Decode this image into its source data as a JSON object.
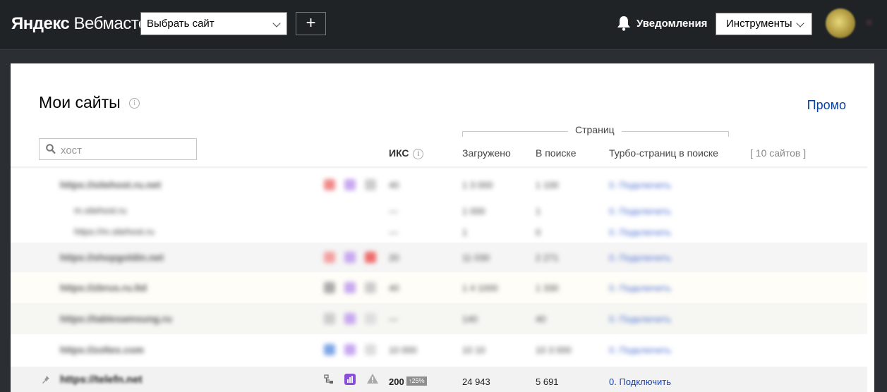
{
  "header": {
    "logo_bold": "Яндекс",
    "logo_rest": "Вебмастер",
    "site_select": "Выбрать сайт",
    "add_label": "+",
    "notifications": "Уведомления",
    "tools": "Инструменты"
  },
  "page": {
    "title": "Мои сайты",
    "info_glyph": "i",
    "promo": "Промо",
    "search_placeholder": "хост"
  },
  "table": {
    "group_label": "Страниц",
    "col_iks": "ИКС",
    "col_loaded": "Загружено",
    "col_in_search": "В поиске",
    "col_turbo": "Турбо-страниц в поиске",
    "site_count": "[ 10 сайтов ]"
  },
  "last_row": {
    "host": "https://telefn.net",
    "iks": "200",
    "iks_change": "↑25%",
    "loaded": "24 943",
    "in_search": "5 691",
    "turbo": "0. Подключить"
  },
  "blurred_rows": [
    {
      "host": "https://sitehost.ru.net",
      "iks": "40",
      "loaded": "1 3 000",
      "in_search": "1 100",
      "turbo": "0. Подключить"
    },
    {
      "host": "m.sitehost.ru",
      "iks": "—",
      "loaded": "1 000",
      "in_search": "1",
      "turbo": "0. Подключить"
    },
    {
      "host": "https://m.sitehost.ru",
      "iks": "—",
      "loaded": "1",
      "in_search": "0",
      "turbo": "0. Подключить"
    },
    {
      "host": "https://shopgoldin.net",
      "iks": "20",
      "loaded": "11 030",
      "in_search": "2 271",
      "turbo": "0. Подключить"
    },
    {
      "host": "https://zbrus.ru.ltd",
      "iks": "40",
      "loaded": "1 4 1000",
      "in_search": "1 330",
      "turbo": "0. Подключить"
    },
    {
      "host": "https://tablesamsung.ru",
      "iks": "—",
      "loaded": "140",
      "in_search": "40",
      "turbo": "0. Подключить"
    },
    {
      "host": "https://zoltex.com",
      "iks": "10 000",
      "loaded": "10 10",
      "in_search": "10 3 000",
      "turbo": "0. Подключить"
    }
  ],
  "colors": {
    "header_bg": "#1f2326",
    "promo": "#0a3f9c",
    "link": "#1a47b8",
    "badge": "#8e8e8e"
  }
}
